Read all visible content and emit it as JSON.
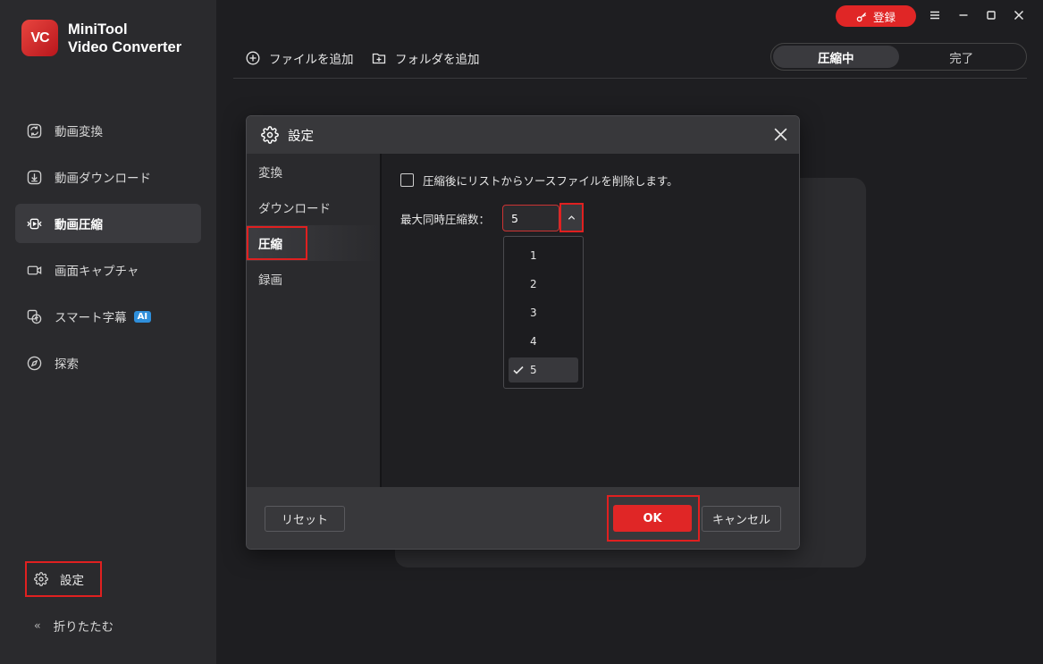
{
  "app": {
    "name_line1": "MiniTool",
    "name_line2": "Video Converter",
    "logo_letters": "VC"
  },
  "sidebar": {
    "items": [
      {
        "label": "動画変換",
        "icon": "convert-icon"
      },
      {
        "label": "動画ダウンロード",
        "icon": "download-icon"
      },
      {
        "label": "動画圧縮",
        "icon": "compress-icon",
        "active": true
      },
      {
        "label": "画面キャプチャ",
        "icon": "camera-icon"
      },
      {
        "label": "スマート字幕",
        "icon": "subtitle-icon",
        "badge": "AI"
      },
      {
        "label": "探索",
        "icon": "compass-icon"
      }
    ],
    "settings_label": "設定",
    "collapse_label": "折りたたむ"
  },
  "titlebar": {
    "register_label": "登録"
  },
  "toolbar": {
    "add_file_label": "ファイルを追加",
    "add_folder_label": "フォルダを追加",
    "tabs": [
      {
        "label": "圧縮中",
        "active": true
      },
      {
        "label": "完了",
        "active": false
      }
    ]
  },
  "dialog": {
    "title": "設定",
    "nav": [
      {
        "label": "変換"
      },
      {
        "label": "ダウンロード"
      },
      {
        "label": "圧縮",
        "active": true
      },
      {
        "label": "録画"
      }
    ],
    "remove_option_label": "圧縮後にリストからソースファイルを削除します。",
    "remove_option_checked": false,
    "max_compress_label": "最大同時圧縮数：",
    "max_compress_value": "5",
    "dropdown_options": [
      "1",
      "2",
      "3",
      "4",
      "5"
    ],
    "dropdown_selected": "5",
    "reset_label": "リセット",
    "ok_label": "OK",
    "cancel_label": "キャンセル"
  },
  "colors": {
    "accent": "#e02626",
    "highlight_border": "#e02020",
    "sidebar_bg": "#2a2a2d",
    "main_bg": "#1e1e21"
  }
}
